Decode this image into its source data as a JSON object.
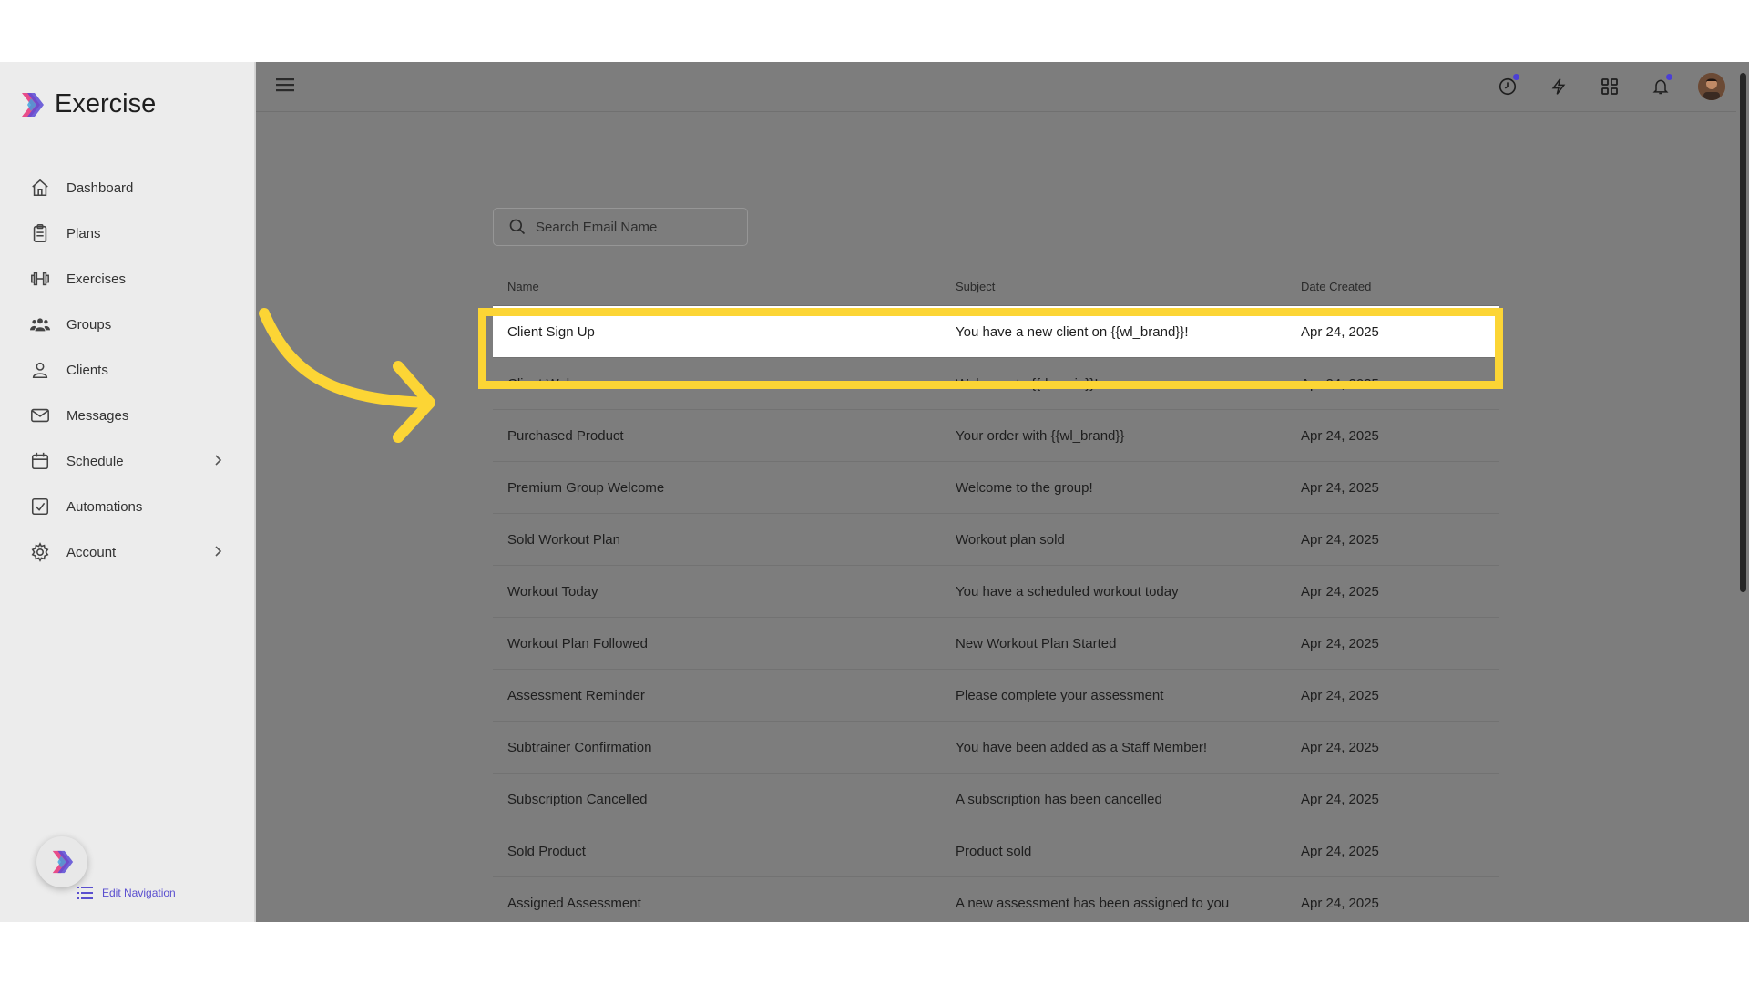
{
  "app": {
    "title": "Exercise"
  },
  "sidebar": {
    "items": [
      {
        "label": "Dashboard",
        "icon": "home-icon"
      },
      {
        "label": "Plans",
        "icon": "clipboard-icon"
      },
      {
        "label": "Exercises",
        "icon": "dumbbell-icon"
      },
      {
        "label": "Groups",
        "icon": "group-icon"
      },
      {
        "label": "Clients",
        "icon": "user-icon"
      },
      {
        "label": "Messages",
        "icon": "mail-icon"
      },
      {
        "label": "Schedule",
        "icon": "calendar-icon"
      },
      {
        "label": "Automations",
        "icon": "checkbox-icon"
      },
      {
        "label": "Account",
        "icon": "gear-icon"
      }
    ],
    "edit_nav_label": "Edit Navigation"
  },
  "search": {
    "placeholder": "Search Email Name"
  },
  "table": {
    "headers": {
      "name": "Name",
      "subject": "Subject",
      "date": "Date Created"
    },
    "rows": [
      {
        "name": "Client Sign Up",
        "subject": "You have a new client on {{wl_brand}}!",
        "date": "Apr 24, 2025"
      },
      {
        "name": "Client Welcome",
        "subject": "Welcome to {{domain}}!",
        "date": "Apr 24, 2025"
      },
      {
        "name": "Purchased Product",
        "subject": "Your order with {{wl_brand}}",
        "date": "Apr 24, 2025"
      },
      {
        "name": "Premium Group Welcome",
        "subject": "Welcome to the group!",
        "date": "Apr 24, 2025"
      },
      {
        "name": "Sold Workout Plan",
        "subject": "Workout plan sold",
        "date": "Apr 24, 2025"
      },
      {
        "name": "Workout Today",
        "subject": "You have a scheduled workout today",
        "date": "Apr 24, 2025"
      },
      {
        "name": "Workout Plan Followed",
        "subject": "New Workout Plan Started",
        "date": "Apr 24, 2025"
      },
      {
        "name": "Assessment Reminder",
        "subject": "Please complete your assessment",
        "date": "Apr 24, 2025"
      },
      {
        "name": "Subtrainer Confirmation",
        "subject": "You have been added as a Staff Member!",
        "date": "Apr 24, 2025"
      },
      {
        "name": "Subscription Cancelled",
        "subject": "A subscription has been cancelled",
        "date": "Apr 24, 2025"
      },
      {
        "name": "Sold Product",
        "subject": "Product sold",
        "date": "Apr 24, 2025"
      },
      {
        "name": "Assigned Assessment",
        "subject": "A new assessment has been assigned to you",
        "date": "Apr 24, 2025"
      }
    ]
  },
  "colors": {
    "accent": "#4b3fd6",
    "highlight": "#fcd535",
    "overlay": "#7d7d7d"
  }
}
